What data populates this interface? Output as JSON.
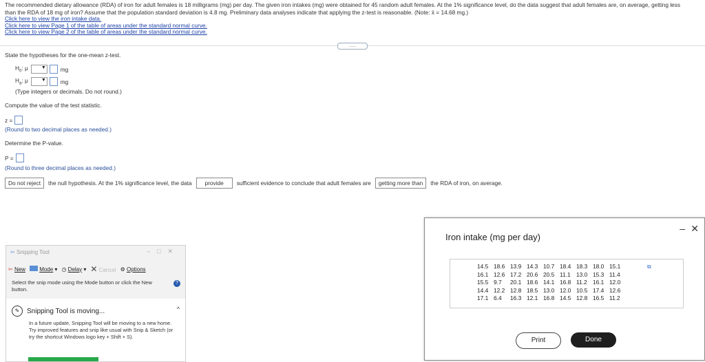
{
  "problem": {
    "text": "The recommended dietary allowance (RDA) of iron for adult females is 18 milligrams (mg) per day. The given iron intakes (mg) were obtained for 45 random adult females. At the 1% significance level, do the data suggest that adult females are, on average, getting less than the RDA of 18 mg of iron? Assume that the population standard deviation is 4.8 mg. Preliminary data analyses indicate that applying the z-test is reasonable. (Note: x̄ = 14.68 mg.)",
    "links": [
      "Click here to view the iron intake data.",
      "Click here to view Page 1 of the table of areas under the standard normal curve.",
      "Click here to view Page 2 of the table of areas under the standard normal curve."
    ],
    "expand_label": "....."
  },
  "hypotheses": {
    "prompt": "State the hypotheses for the one-mean z-test.",
    "h0_label": "H",
    "h0_sub": "0",
    "ha_label": "H",
    "ha_sub": "a",
    "mu": ": μ",
    "unit": "mg",
    "note": "(Type integers or decimals. Do not round.)"
  },
  "statistic": {
    "prompt": "Compute the value of the test statistic.",
    "label": "z =",
    "note": "(Round to two decimal places as needed.)"
  },
  "pvalue": {
    "prompt": "Determine the P-value.",
    "label": "P =",
    "note": "(Round to three decimal places as needed.)"
  },
  "conclusion": {
    "select1": "Do not reject",
    "text1": "the null hypothesis. At the 1% significance level, the data",
    "select2": "provide",
    "text2": "sufficient evidence to conclude that adult females are",
    "select3": "getting more than",
    "text3": "the RDA of iron, on average."
  },
  "snipping_tool": {
    "title": "Snipping Tool",
    "new": "New",
    "mode": "Mode",
    "delay": "Delay",
    "cancel": "Cancel",
    "options": "Options",
    "message": "Select the snip mode using the Mode button or click the New button.",
    "panel_title": "Snipping Tool is moving...",
    "panel_body": "In a future update, Snipping Tool will be moving to a new home. Try improved features and snip like usual with Snip & Sketch (or try the shortcut Windows logo key + Shift + S)."
  },
  "data_dialog": {
    "title": "Iron intake (mg per day)",
    "rows": [
      [
        "14.5",
        "18.6",
        "13.9",
        "14.3",
        "10.7",
        "18.4",
        "18.3",
        "18.0",
        "15.1"
      ],
      [
        "16.1",
        "12.6",
        "17.2",
        "20.6",
        "20.5",
        "11.1",
        "13.0",
        "15.3",
        "11.4"
      ],
      [
        "15.5",
        "9.7",
        "20.1",
        "18.6",
        "14.1",
        "16.8",
        "11.2",
        "16.1",
        "12.0"
      ],
      [
        "14.4",
        "12.2",
        "12.8",
        "18.5",
        "13.0",
        "12.0",
        "10.5",
        "17.4",
        "12.6"
      ],
      [
        "17.1",
        "6.4",
        "16.3",
        "12.1",
        "16.8",
        "14.5",
        "12.8",
        "16.5",
        "11.2"
      ]
    ],
    "print": "Print",
    "done": "Done"
  }
}
